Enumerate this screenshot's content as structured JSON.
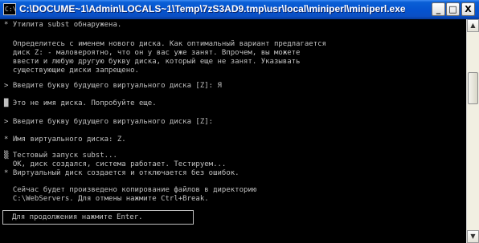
{
  "window": {
    "title": "C:\\DOCUME~1\\Admin\\LOCALS~1\\Temp\\7zS3AD9.tmp\\usr\\local\\miniperl\\miniperl.exe",
    "icon_glyph": "C:\\",
    "min_glyph": "_",
    "max_glyph": "□",
    "close_glyph": "X"
  },
  "console": {
    "lines": [
      "* Утилита subst обнаружена.",
      "",
      "  Определитесь с именем нового диска. Как оптимальный вариант предлагается",
      "  диск Z: - маловероятно, что он у вас уже занят. Впрочем, вы можете",
      "  ввести и любую другую букву диска, который еще не занят. Указывать",
      "  существующие диски запрещено.",
      "",
      "> Введите букву будущего виртуального диска [Z]: Я",
      "",
      "█ Это не имя диска. Попробуйте еще.",
      "",
      "> Введите букву будущего виртуального диска [Z]:",
      "",
      "* Имя виртуального диска: Z.",
      "",
      "▒ Тестовый запуск subst...",
      "  OK, диск создался, система работает. Тестируем...",
      "* Виртуальный диск создается и отключается без ошибок.",
      "",
      "  Сейчас будет произведено копирование файлов в директорию",
      "  C:\\WebServers. Для отмены нажмите Ctrl+Break."
    ],
    "prompt": "Для продолжения нажмите Enter."
  },
  "scrollbar": {
    "up_glyph": "▲",
    "down_glyph": "▼"
  }
}
